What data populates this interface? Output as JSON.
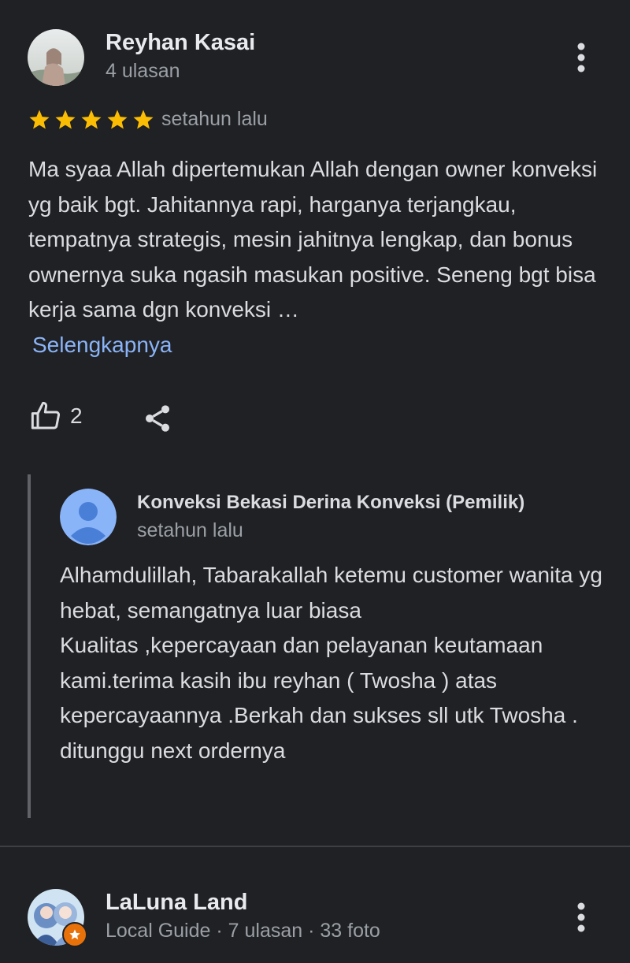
{
  "review1": {
    "reviewer_name": "Reyhan Kasai",
    "reviewer_meta": "4 ulasan",
    "rating": 5,
    "time": "setahun lalu",
    "text": "Ma syaa Allah dipertemukan Allah dengan owner konveksi yg baik bgt. Jahitannya rapi, harganya terjangkau, tempatnya strategis, mesin jahitnya lengkap, dan bonus ownernya suka ngasih masukan positive. Seneng bgt bisa kerja sama dgn konveksi …",
    "read_more": "Selengkapnya",
    "like_count": "2",
    "owner_reply": {
      "name": "Konveksi Bekasi Derina Konveksi (Pemilik)",
      "time": "setahun lalu",
      "text": "Alhamdulillah, Tabarakallah ketemu customer wanita yg hebat, semangatnya luar biasa\nKualitas ,kepercayaan dan pelayanan keutamaan kami.terima kasih ibu reyhan ( Twosha ) atas kepercayaannya .Berkah dan sukses sll utk Twosha .\nditunggu next ordernya"
    }
  },
  "review2": {
    "reviewer_name": "LaLuna Land",
    "reviewer_meta": "Local Guide · 7 ulasan · 33 foto"
  },
  "icons": {
    "star": "star-icon",
    "like": "thumb-up-icon",
    "share": "share-icon",
    "more": "more-vert-icon",
    "owner_avatar": "person-icon"
  },
  "colors": {
    "background": "#202124",
    "star": "#fbbc04",
    "link": "#8ab4f8",
    "owner_avatar": "#8ab4f8"
  }
}
